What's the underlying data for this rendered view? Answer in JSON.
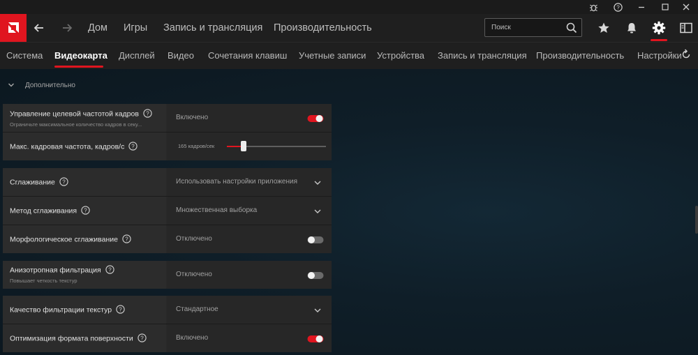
{
  "header": {
    "nav": [
      "Дом",
      "Игры",
      "Запись и трансляция",
      "Производительность"
    ],
    "search_placeholder": "Поиск"
  },
  "tabs": [
    "Система",
    "Видеокарта",
    "Дисплей",
    "Видео",
    "Сочетания клавиш",
    "Учетные записи",
    "Устройства",
    "Запись и трансляция",
    "Производительность",
    "Настройки"
  ],
  "active_tab": "Видеокарта",
  "section": {
    "title": "Дополнительно"
  },
  "settings": {
    "frame_rate_target": {
      "title": "Управление целевой частотой кадров",
      "subtitle": "Ограничьте максимальное количество кадров в секу...",
      "value": "Включено",
      "on": true
    },
    "max_fps": {
      "title": "Макс. кадровая частота, кадров/с",
      "value": "165 кадров/сек",
      "level": 0.17
    },
    "anti_aliasing": {
      "title": "Сглаживание",
      "value": "Использовать настройки приложения"
    },
    "aa_method": {
      "title": "Метод сглаживания",
      "value": "Множественная выборка"
    },
    "morphological_aa": {
      "title": "Морфологическое сглаживание",
      "value": "Отключено",
      "on": false
    },
    "anisotropic": {
      "title": "Анизотропная фильтрация",
      "subtitle": "Повышает четкость текстур",
      "value": "Отключено",
      "on": false
    },
    "texture_quality": {
      "title": "Качество фильтрации текстур",
      "value": "Стандартное"
    },
    "surface_format": {
      "title": "Оптимизация формата поверхности",
      "value": "Включено",
      "on": true
    }
  },
  "colors": {
    "accent": "#e0151f",
    "header_bg": "#1f1f1f",
    "panel_bg": "#282828",
    "page_bg": "#0f1b24"
  },
  "icons": [
    "bug-icon",
    "help-icon",
    "minimize-icon",
    "maximize-icon",
    "close-icon",
    "amd-logo",
    "back-arrow-icon",
    "forward-arrow-icon",
    "search-icon",
    "star-icon",
    "bell-icon",
    "gear-icon",
    "sidebar-icon",
    "reset-icon",
    "chevron-down-icon",
    "question-icon"
  ]
}
